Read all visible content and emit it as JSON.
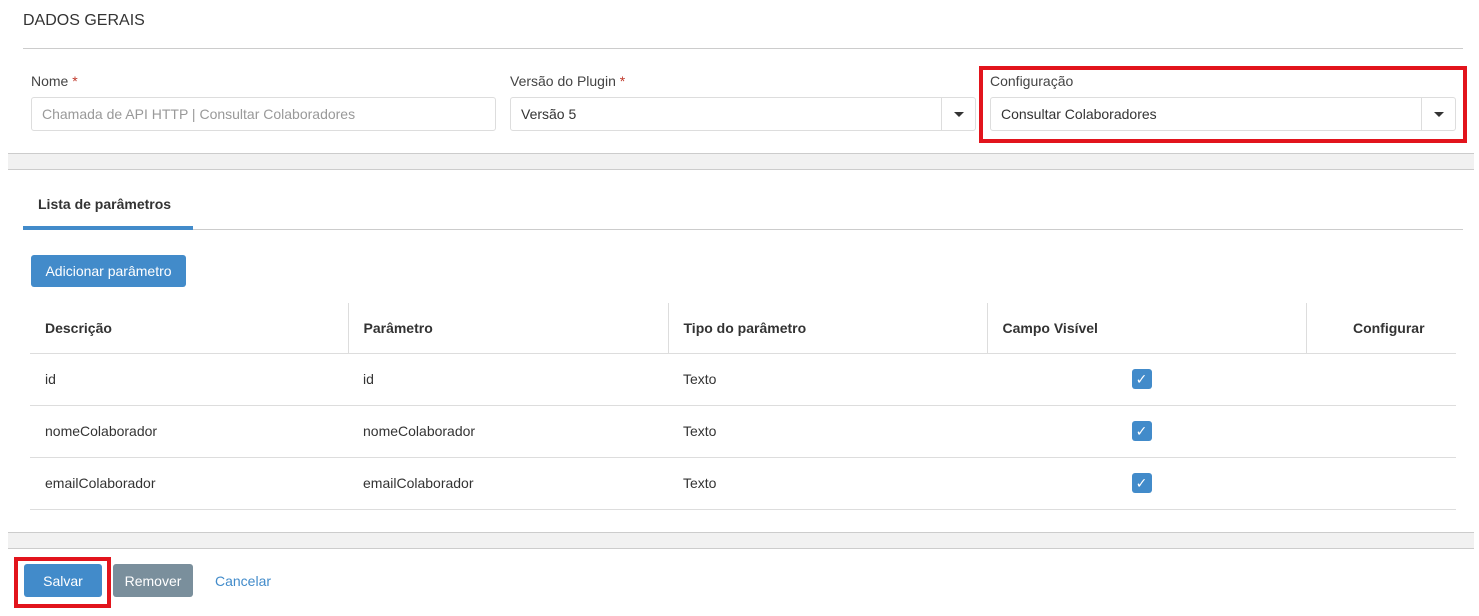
{
  "section_title": "DADOS GERAIS",
  "form": {
    "nome_label": "Nome",
    "nome_placeholder": "Chamada de API HTTP | Consultar Colaboradores",
    "versao_label": "Versão do Plugin",
    "versao_value": "Versão 5",
    "config_label": "Configuração",
    "config_value": "Consultar Colaboradores",
    "required_mark": "*"
  },
  "tab": {
    "label": "Lista de parâmetros"
  },
  "add_button": "Adicionar parâmetro",
  "table": {
    "headers": [
      "Descrição",
      "Parâmetro",
      "Tipo do parâmetro",
      "Campo Visível",
      "Configurar"
    ],
    "rows": [
      {
        "descricao": "id",
        "parametro": "id",
        "tipo": "Texto",
        "visivel": true
      },
      {
        "descricao": "nomeColaborador",
        "parametro": "nomeColaborador",
        "tipo": "Texto",
        "visivel": true
      },
      {
        "descricao": "emailColaborador",
        "parametro": "emailColaborador",
        "tipo": "Texto",
        "visivel": true
      }
    ]
  },
  "footer": {
    "save": "Salvar",
    "remove": "Remover",
    "cancel": "Cancelar"
  },
  "colors": {
    "primary": "#428bca",
    "highlight": "#e2141c",
    "secondary": "#7a8f9c"
  }
}
